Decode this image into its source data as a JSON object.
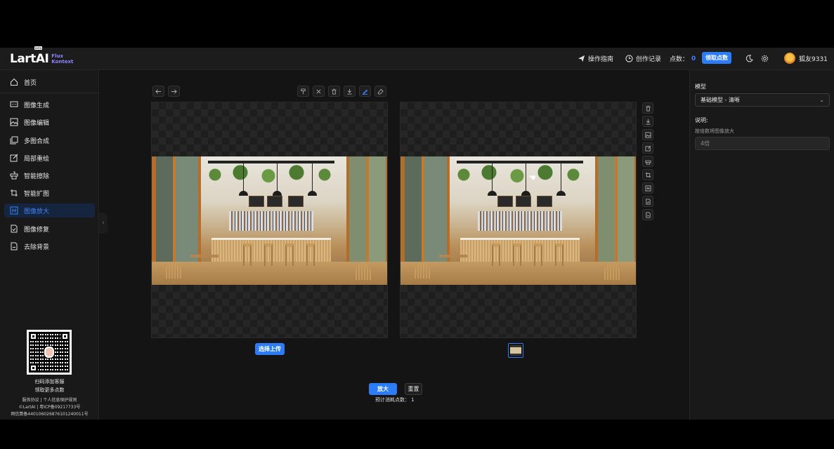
{
  "header": {
    "logo_main": "LartAI",
    "logo_badge": "beta",
    "logo_sub_1": "Flux",
    "logo_sub_2": "Kontext",
    "guide_label": "操作指南",
    "history_label": "创作记录",
    "points_label": "点数：",
    "points_value": "0",
    "claim_button": "领取点数",
    "username": "狐友9331"
  },
  "sidebar": {
    "items": [
      {
        "label": "首页",
        "icon": "home-icon"
      },
      {
        "label": "图像生成",
        "icon": "chat-icon"
      },
      {
        "label": "图像编辑",
        "icon": "image-icon"
      },
      {
        "label": "多图合成",
        "icon": "layers-icon"
      },
      {
        "label": "局部重绘",
        "icon": "edit-icon"
      },
      {
        "label": "智能擦除",
        "icon": "eraser-icon"
      },
      {
        "label": "智能扩图",
        "icon": "crop-icon"
      },
      {
        "label": "图像放大",
        "icon": "upscale-icon",
        "active": true
      },
      {
        "label": "图像修复",
        "icon": "repair-icon"
      },
      {
        "label": "去除背景",
        "icon": "remove-bg-icon"
      }
    ],
    "qr_caption_1": "扫码添加客服",
    "qr_caption_2": "领取更多点数",
    "footer_1": "服务协议 | 个人信息保护规则",
    "footer_2": "©LartAI | 粤ICP备09217733号",
    "footer_3": "网信算备440106026876101240011号"
  },
  "workspace": {
    "upload_button": "选择上传",
    "enlarge_button": "放大",
    "reset_button": "重置",
    "cost_text": "预计消耗点数： 1"
  },
  "right_panel": {
    "model_label": "模型",
    "model_value": "基础模型 - 清晰",
    "desc_label": "说明:",
    "desc_hint": "按倍数将图像放大",
    "scale_placeholder": "4倍"
  },
  "colors": {
    "accent": "#2b7cf6",
    "background": "#141414",
    "panel": "#191919"
  }
}
